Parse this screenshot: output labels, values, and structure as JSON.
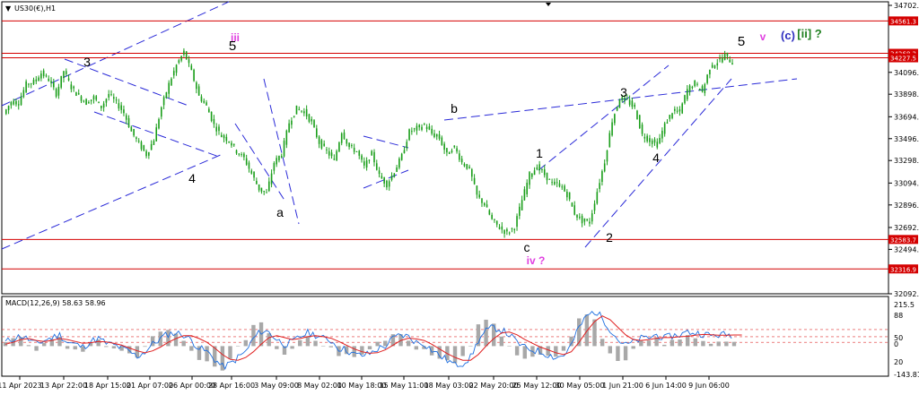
{
  "symbol_title": "US30(€),H1",
  "macd_label": "MACD(12,26,9) 58.63 58.96",
  "colors": {
    "candle": "#1a9e1a",
    "candle_down": "#c81a1a",
    "hline": "#d40000",
    "trendline": "#2a2ad8",
    "macd_line": "#1e6fe0",
    "macd_signal": "#e02020",
    "macd_hist": "#a8a8a8",
    "wave_black": "#000000",
    "wave_magenta": "#e040e0",
    "wave_blue": "#3030c0",
    "wave_green": "#208020"
  },
  "chart_data": [
    {
      "type": "candlestick",
      "ylim": [
        32000,
        34760
      ],
      "y_ticks": [
        "34702.0",
        "34561.3",
        "34268.2",
        "34227.5",
        "34096.0",
        "33898.0",
        "33694.0",
        "33496.0",
        "33298.0",
        "33094.0",
        "32896.0",
        "32692.0",
        "32583.7",
        "32494.0",
        "32316.9",
        "32092.0"
      ],
      "x_ticks": [
        "11 Apr 2023",
        "13 Apr 22:00",
        "18 Apr 15:00",
        "21 Apr 07:00",
        "26 Apr 00:00",
        "28 Apr 16:00",
        "3 May 09:00",
        "8 May 02:00",
        "10 May 18:00",
        "15 May 11:00",
        "18 May 03:00",
        "22 May 20:00",
        "25 May 12:00",
        "30 May 05:00",
        "1 Jun 21:00",
        "6 Jun 14:00",
        "9 Jun 06:00"
      ],
      "price_levels": [
        {
          "label": "34561.3",
          "value": 34561.3
        },
        {
          "label": "34268.2",
          "value": 34268.2
        },
        {
          "label": "34227.5",
          "value": 34227.5
        },
        {
          "label": "32583.7",
          "value": 32583.7
        },
        {
          "label": "32316.9",
          "value": 32316.9
        }
      ],
      "series": [
        {
          "values": [
            33720,
            33830,
            33820,
            33990,
            34010,
            34090,
            34030,
            33900,
            34110,
            33960,
            33880,
            33820,
            33870,
            33780,
            33900,
            33820,
            33730,
            33560,
            33450,
            33350,
            33490,
            33780,
            33990,
            34160,
            34280,
            34100,
            33880,
            33790,
            33620,
            33520,
            33480,
            33380,
            33320,
            33180,
            33040,
            33000,
            33280,
            33360,
            33640,
            33770,
            33740,
            33640,
            33460,
            33380,
            33300,
            33560,
            33420,
            33380,
            33240,
            33360,
            33160,
            33080,
            33200,
            33340,
            33560,
            33590,
            33620,
            33540,
            33500,
            33350,
            33420,
            33280,
            33220,
            32980,
            32900,
            32760,
            32690,
            32640,
            32700,
            32940,
            33170,
            33240,
            33170,
            33090,
            33080,
            32990,
            32820,
            32750,
            32740,
            33020,
            33290,
            33660,
            33860,
            33840,
            33770,
            33530,
            33480,
            33440,
            33620,
            33740,
            33740,
            33940,
            34000,
            33920,
            34140,
            34190,
            34250,
            34180
          ]
        }
      ],
      "wave_labels": [
        {
          "text": "3",
          "color": "wave_black"
        },
        {
          "text": "4",
          "color": "wave_black"
        },
        {
          "text": "iii",
          "color": "wave_magenta"
        },
        {
          "text": "5",
          "color": "wave_black"
        },
        {
          "text": "a",
          "color": "wave_black"
        },
        {
          "text": "b",
          "color": "wave_black"
        },
        {
          "text": "c",
          "color": "wave_black"
        },
        {
          "text": "iv ?",
          "color": "wave_magenta"
        },
        {
          "text": "1",
          "color": "wave_black"
        },
        {
          "text": "2",
          "color": "wave_black"
        },
        {
          "text": "3",
          "color": "wave_black"
        },
        {
          "text": "4",
          "color": "wave_black"
        },
        {
          "text": "5",
          "color": "wave_black"
        },
        {
          "text": "v",
          "color": "wave_magenta"
        },
        {
          "text": "(c)",
          "color": "wave_blue"
        },
        {
          "text": "[ii] ?",
          "color": "wave_green"
        }
      ]
    },
    {
      "type": "macd",
      "ylim": [
        -150,
        230
      ],
      "y_ticks": [
        "215.5",
        "88",
        "50",
        "0",
        "20",
        "-143.81"
      ],
      "macd": [
        20,
        40,
        55,
        35,
        10,
        30,
        45,
        60,
        20,
        10,
        -5,
        25,
        40,
        15,
        5,
        -10,
        -30,
        -55,
        -30,
        10,
        40,
        65,
        70,
        60,
        30,
        -10,
        -30,
        -70,
        -110,
        -95,
        -60,
        -30,
        40,
        80,
        75,
        35,
        10,
        20,
        50,
        70,
        60,
        40,
        30,
        -10,
        -20,
        -45,
        -50,
        -40,
        -15,
        0,
        40,
        60,
        50,
        20,
        15,
        -20,
        -50,
        -75,
        -100,
        -90,
        -60,
        30,
        80,
        100,
        85,
        60,
        20,
        -10,
        -20,
        -30,
        -45,
        -60,
        -50,
        5,
        100,
        160,
        185,
        150,
        90,
        35,
        5,
        20,
        40,
        45,
        60,
        40,
        55,
        60,
        75,
        70,
        65,
        55,
        60,
        60,
        60
      ],
      "signal": [
        10,
        20,
        35,
        40,
        30,
        25,
        30,
        40,
        35,
        25,
        15,
        18,
        25,
        22,
        15,
        5,
        -10,
        -25,
        -35,
        -25,
        -5,
        20,
        40,
        55,
        55,
        40,
        20,
        -10,
        -45,
        -70,
        -75,
        -60,
        -30,
        10,
        45,
        55,
        45,
        35,
        40,
        50,
        55,
        50,
        42,
        25,
        5,
        -15,
        -30,
        -38,
        -35,
        -20,
        5,
        30,
        42,
        38,
        30,
        10,
        -15,
        -40,
        -60,
        -75,
        -75,
        -45,
        0,
        40,
        70,
        75,
        60,
        35,
        15,
        -5,
        -20,
        -35,
        -45,
        -30,
        20,
        80,
        130,
        160,
        140,
        100,
        60,
        35,
        30,
        35,
        42,
        45,
        45,
        50,
        52,
        58,
        62,
        60,
        58,
        58,
        59,
        59
      ]
    }
  ]
}
